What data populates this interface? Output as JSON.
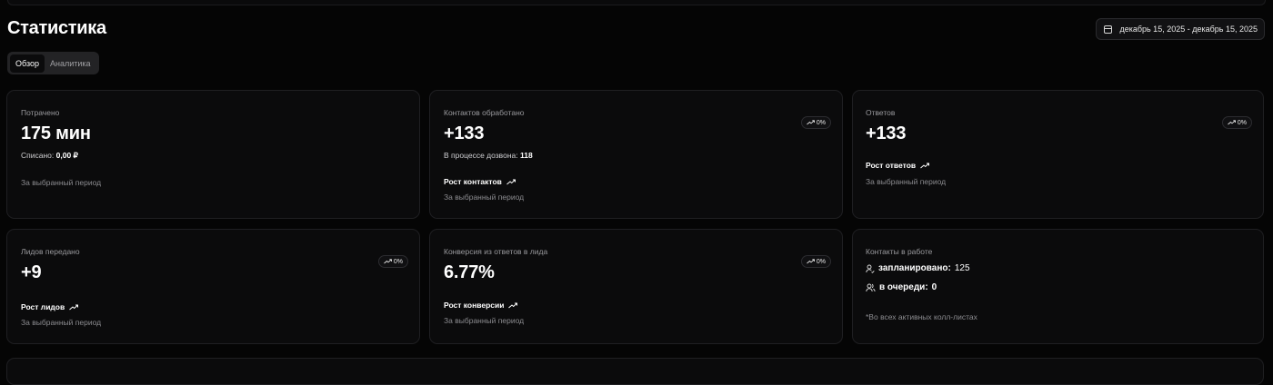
{
  "header": {
    "title": "Статистика",
    "date_range": "декабрь 15, 2025 - декабрь 15, 2025"
  },
  "tabs": [
    {
      "label": "Обзор",
      "active": true
    },
    {
      "label": "Аналитика",
      "active": false
    }
  ],
  "cards": {
    "spent": {
      "label": "Потрачено",
      "value": "175 мин",
      "charged_label": "Списано:",
      "charged_value": "0,00 ₽",
      "period": "За выбранный период"
    },
    "contacts": {
      "label": "Контактов обработано",
      "value": "+133",
      "badge": "0%",
      "in_progress_label": "В процессе дозвона:",
      "in_progress_value": "118",
      "growth": "Рост контактов",
      "period": "За выбранный период"
    },
    "answers": {
      "label": "Ответов",
      "value": "+133",
      "badge": "0%",
      "growth": "Рост ответов",
      "period": "За выбранный период"
    },
    "leads": {
      "label": "Лидов передано",
      "value": "+9",
      "badge": "0%",
      "growth": "Рост лидов",
      "period": "За выбранный период"
    },
    "conversion": {
      "label": "Конверсия из ответов в лида",
      "value": "6.77%",
      "badge": "0%",
      "growth": "Рост конверсии",
      "period": "За выбранный период"
    },
    "in_work": {
      "label": "Контакты в работе",
      "scheduled_label": "запланировано:",
      "scheduled_value": "125",
      "queued_label": "в очереди:",
      "queued_value": "0",
      "note": "*Во всех активных колл-листах"
    }
  }
}
